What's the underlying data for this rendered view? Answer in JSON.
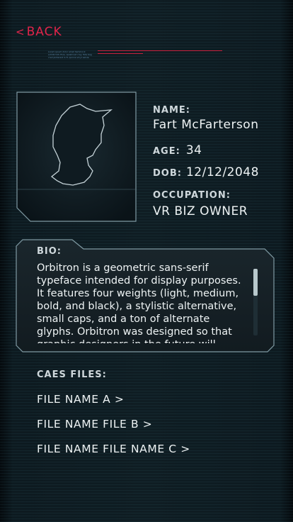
{
  "nav": {
    "back_label": "BACK",
    "back_chevron": "<"
  },
  "header": {
    "fine_print": "Lorem ipsum dolor amet hammock schlitz tofu fixie, waistcoat cray. Tote bag cred pinterest lo-fi, quinoa vinyl salvia.",
    "accent_color": "#e0244a"
  },
  "profile": {
    "name_label": "NAME:",
    "name": "Fart McFarterson",
    "age_label": "AGE:",
    "age": "34",
    "dob_label": "DOB:",
    "dob": "12/12/2048",
    "occupation_label": "OCCUPATION:",
    "occupation": "VR BIZ OWNER",
    "avatar_icon": "person-silhouette-icon"
  },
  "bio": {
    "label": "BIO:",
    "text": "Orbitron is a geometric sans-serif typeface intended for display purposes. It features four weights (light, medium, bold, and black), a stylistic alternative, small caps, and a ton of alternate glyphs. Orbitron was designed so that graphic designers in the future will have some alternative typefaces to choose from."
  },
  "cases": {
    "label": "CAES FILES:",
    "files": [
      "FILE NAME A >",
      "FILE NAME FILE B >",
      "FILE NAME FILE NAME C >"
    ]
  }
}
